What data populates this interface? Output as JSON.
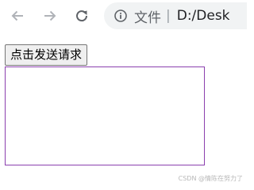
{
  "browser": {
    "back_icon": "back-arrow-icon",
    "forward_icon": "forward-arrow-icon",
    "reload_icon": "reload-icon",
    "info_icon": "info-icon",
    "site_label": "文件",
    "separator": "|",
    "url": "D:/Desk",
    "icon_color": "#b0b3b8",
    "reload_color": "#5f6368",
    "address_bg": "#f1f3f4"
  },
  "page": {
    "send_button_label": "点击发送请求",
    "output_border_color": "#8b3fae",
    "watermark": "CSDN @情陈在努力了"
  }
}
